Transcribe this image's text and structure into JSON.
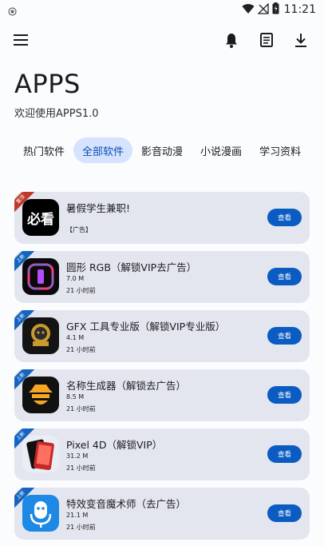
{
  "status_bar": {
    "time": "11:21"
  },
  "header": {
    "title": "APPS",
    "subtitle": "欢迎使用APPS1.0"
  },
  "toolbar": {
    "icons": [
      "menu-icon",
      "bell-icon",
      "notes-icon",
      "download-icon"
    ]
  },
  "tabs": [
    {
      "label": "热门软件",
      "active": false
    },
    {
      "label": "全部软件",
      "active": true
    },
    {
      "label": "影音动漫",
      "active": false
    },
    {
      "label": "小说漫画",
      "active": false
    },
    {
      "label": "学习资料",
      "active": false
    }
  ],
  "apps": [
    {
      "ribbon": "置顶",
      "ribbon_color": "#c0392b",
      "name": "暑假学生兼职!",
      "icon_text": "必看",
      "ad_label": "【广告】",
      "button": "查看"
    },
    {
      "ribbon": "上新",
      "ribbon_color": "#1565c0",
      "name": "圆形 RGB（解锁VIP去广告）",
      "size": "7.0 M",
      "time": "21 小时前",
      "button": "查看"
    },
    {
      "ribbon": "上新",
      "ribbon_color": "#1565c0",
      "name": "GFX 工具专业版（解锁VIP专业版）",
      "size": "4.1 M",
      "time": "21 小时前",
      "button": "查看"
    },
    {
      "ribbon": "上新",
      "ribbon_color": "#1565c0",
      "name": "名称生成器（解锁去广告）",
      "size": "8.5 M",
      "time": "21 小时前",
      "button": "查看"
    },
    {
      "ribbon": "上新",
      "ribbon_color": "#1565c0",
      "name": "Pixel 4D（解锁VIP）",
      "size": "31.2 M",
      "time": "21 小时前",
      "button": "查看"
    },
    {
      "ribbon": "上新",
      "ribbon_color": "#1565c0",
      "name": "特效变音魔术师（去广告）",
      "size": "21.1 M",
      "time": "21 小时前",
      "button": "查看"
    }
  ]
}
